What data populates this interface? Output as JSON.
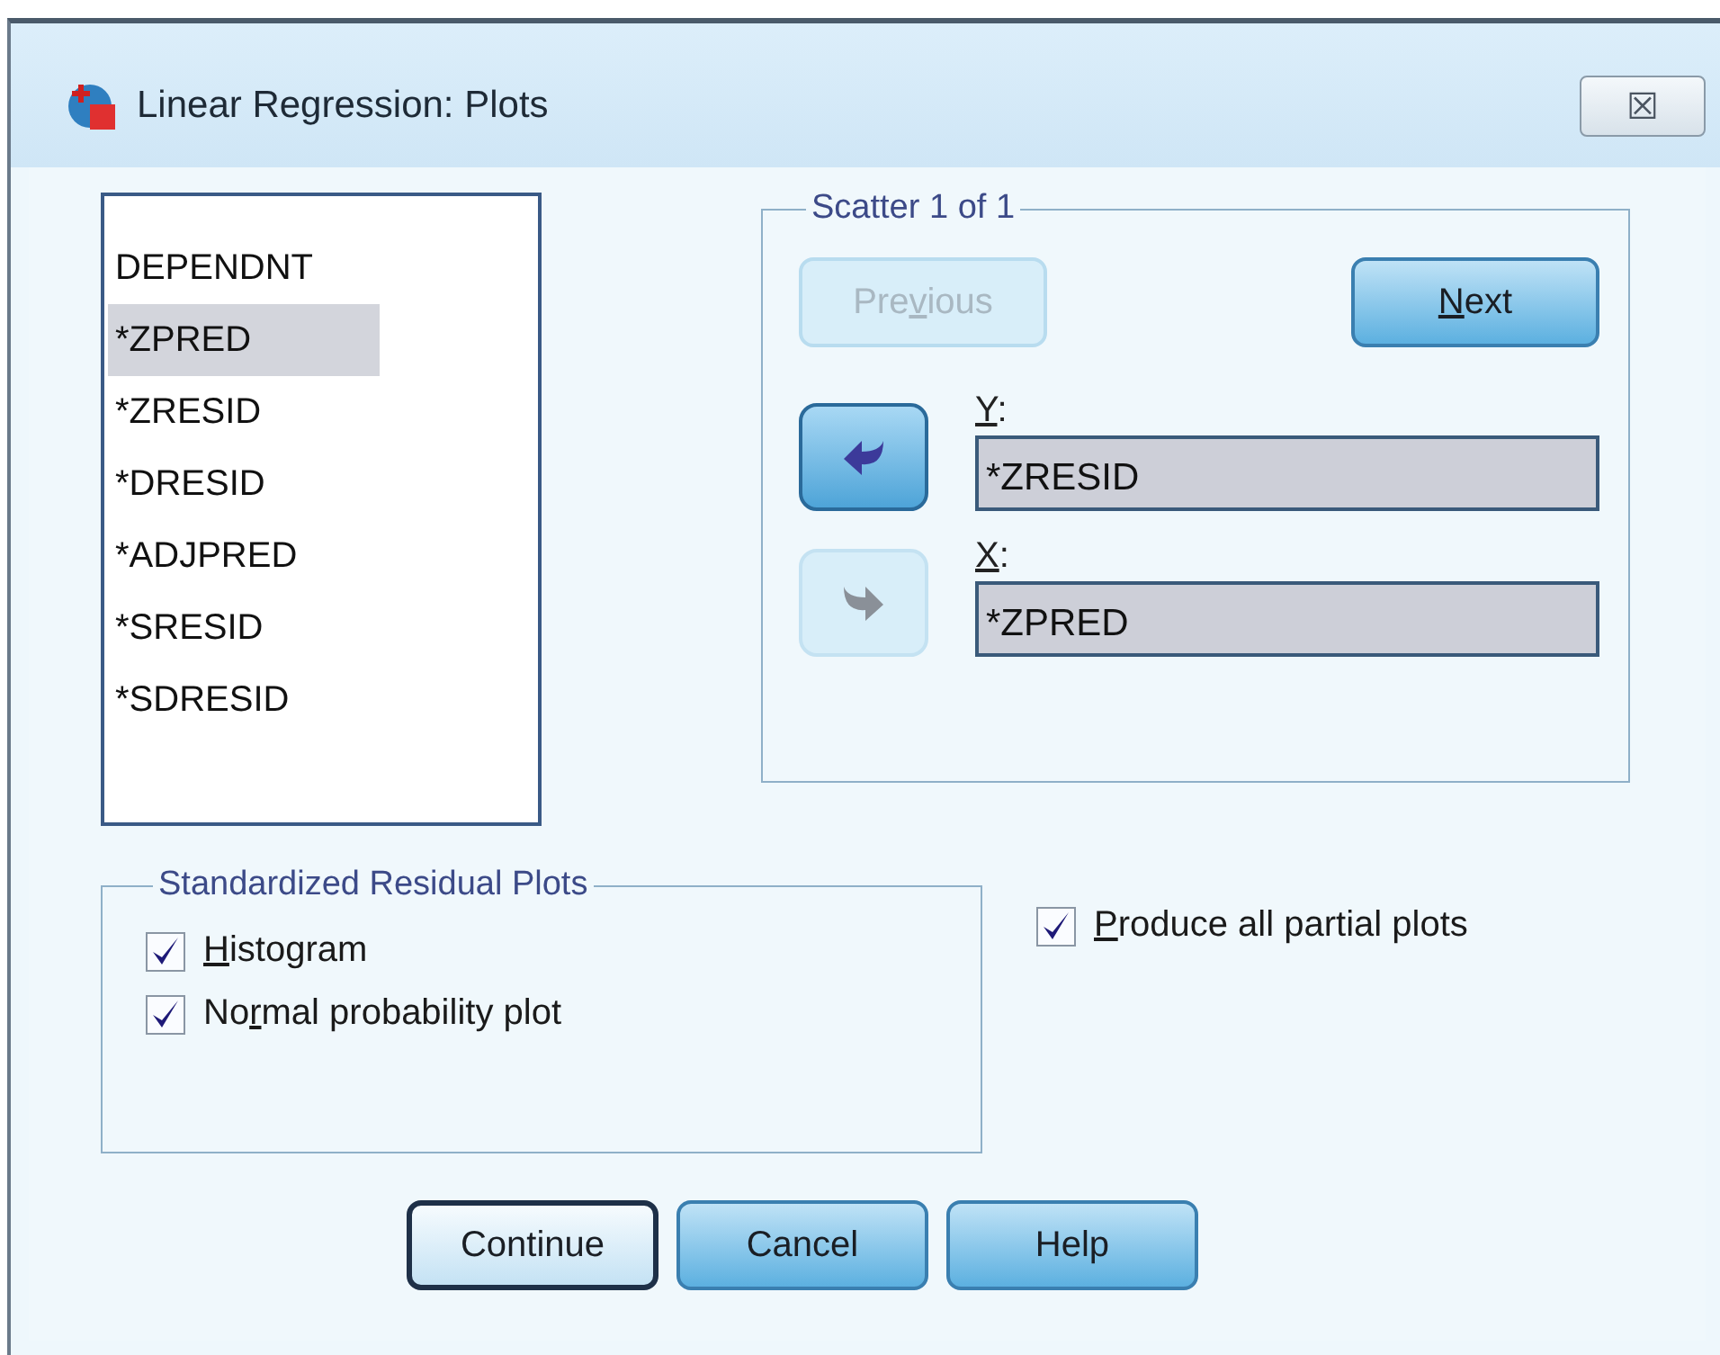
{
  "window": {
    "title": "Linear Regression: Plots",
    "close_label": "☒"
  },
  "variables": [
    {
      "label": "DEPENDNT",
      "selected": false
    },
    {
      "label": "*ZPRED",
      "selected": true
    },
    {
      "label": "*ZRESID",
      "selected": false
    },
    {
      "label": "*DRESID",
      "selected": false
    },
    {
      "label": "*ADJPRED",
      "selected": false
    },
    {
      "label": "*SRESID",
      "selected": false
    },
    {
      "label": "*SDRESID",
      "selected": false
    }
  ],
  "scatter": {
    "title": "Scatter 1 of 1",
    "previous": {
      "label": {
        "before": "Pre",
        "key": "v",
        "after": "ious"
      },
      "disabled": true
    },
    "next": {
      "label": {
        "key": "N",
        "after": "ext"
      },
      "disabled": false
    },
    "axes": [
      {
        "label": {
          "key": "Y",
          "after": ":"
        },
        "value": "*ZRESID",
        "arrow_disabled": false,
        "kind": "left"
      },
      {
        "label": {
          "key": "X",
          "after": ":"
        },
        "value": "*ZPRED",
        "arrow_disabled": true,
        "kind": "right"
      }
    ]
  },
  "residual_plots": {
    "title": "Standardized Residual Plots",
    "options": [
      {
        "label": {
          "key": "H",
          "after": "istogram"
        },
        "checked": true
      },
      {
        "label": {
          "before": "No",
          "key": "r",
          "after": "mal probability plot"
        },
        "checked": true
      }
    ]
  },
  "partial_plots": {
    "label": {
      "key": "P",
      "after": "roduce all partial plots"
    },
    "checked": true
  },
  "buttons": [
    {
      "label": "Continue",
      "default": true
    },
    {
      "label": "Cancel",
      "default": false
    },
    {
      "label": "Help",
      "default": false
    }
  ]
}
